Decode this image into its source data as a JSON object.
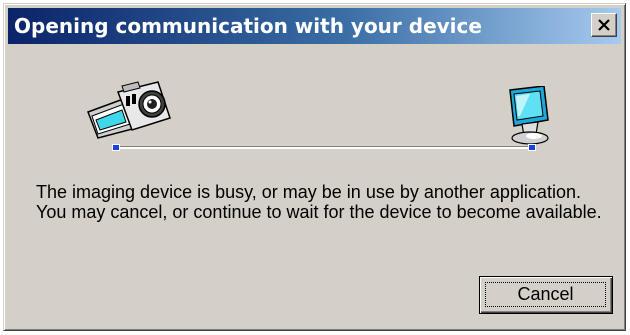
{
  "dialog": {
    "title": "Opening communication with your device",
    "close_label": "close-icon",
    "message": "The imaging device is busy, or may be in use by another application.  You may cancel, or continue to wait for the device to become available.",
    "cancel_label": "Cancel"
  },
  "icons": {
    "source": "camera-icon",
    "destination": "computer-icon"
  },
  "colors": {
    "titlebar_start": "#0a246a",
    "titlebar_end": "#a6caf0",
    "dialog_face": "#d4d0c8",
    "node": "#1b3fe0"
  }
}
